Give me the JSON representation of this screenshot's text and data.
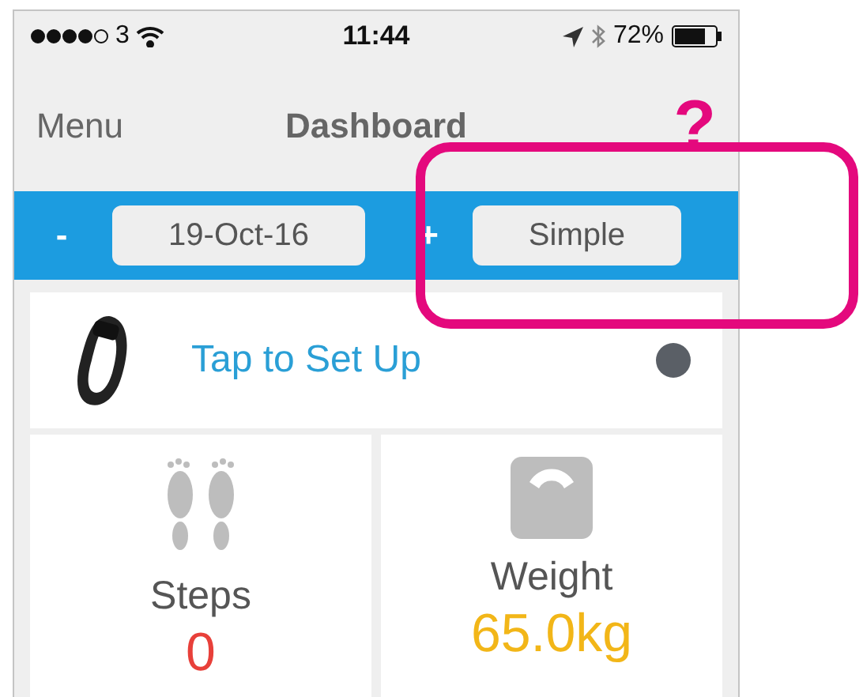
{
  "status_bar": {
    "carrier": "3",
    "time": "11:44",
    "battery": "72%"
  },
  "nav": {
    "left": "Menu",
    "title": "Dashboard",
    "help": "?"
  },
  "date_bar": {
    "minus": "-",
    "date": "19-Oct-16",
    "plus": "+",
    "mode": "Simple"
  },
  "device": {
    "label": "Tap to Set Up"
  },
  "tiles": [
    {
      "kind": "steps",
      "label": "Steps",
      "value": "0",
      "color": "#e8403a"
    },
    {
      "kind": "weight",
      "label": "Weight",
      "value": "65.0kg",
      "color": "#f2b618"
    }
  ]
}
